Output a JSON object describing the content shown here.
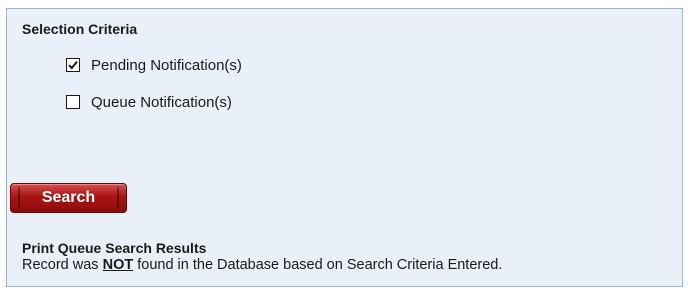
{
  "selection_criteria": {
    "title": "Selection Criteria",
    "options": [
      {
        "label": "Pending Notification(s)",
        "checked": true
      },
      {
        "label": "Queue Notification(s)",
        "checked": false
      }
    ]
  },
  "search_button": {
    "label": "Search"
  },
  "results": {
    "title": "Print Queue Search Results",
    "message_before": "Record was ",
    "message_emphasis": "NOT",
    "message_after": " found in the Database based on Search Criteria Entered."
  },
  "colors": {
    "panel_bg": "#eaf0f7",
    "panel_border": "#9ab6d4",
    "button_red": "#a81414"
  },
  "icons": {
    "checked": "checkmark-icon"
  }
}
